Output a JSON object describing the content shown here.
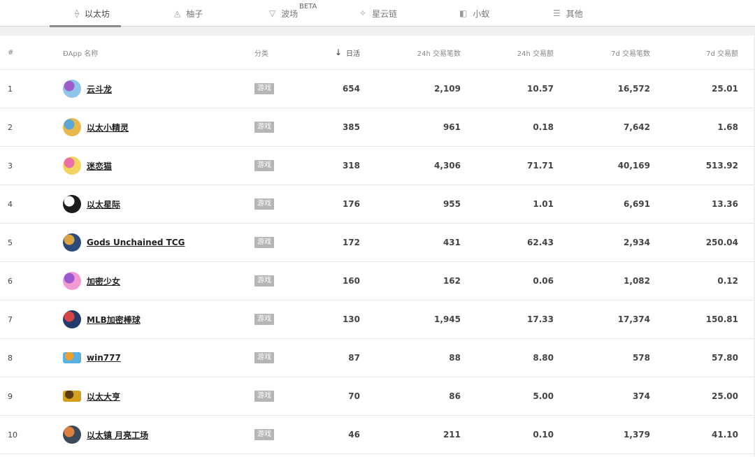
{
  "tabs": [
    {
      "label": "以太坊",
      "icon": "ethereum-icon",
      "glyph": "⟠",
      "active": true
    },
    {
      "label": "柚子",
      "icon": "eos-icon",
      "glyph": "◬"
    },
    {
      "label": "波场",
      "icon": "tron-icon",
      "glyph": "▽",
      "sup": "BETA"
    },
    {
      "label": "星云链",
      "icon": "nebulas-icon",
      "glyph": "✧"
    },
    {
      "label": "小蚁",
      "icon": "neo-icon",
      "glyph": "◧"
    },
    {
      "label": "其他",
      "icon": "menu-icon",
      "glyph": "☰"
    }
  ],
  "table": {
    "headers": {
      "rank": "#",
      "name": "ÐApp 名称",
      "category": "分类",
      "dau": "日活",
      "tx24": "24h 交易笔数",
      "vol24": "24h 交易额",
      "tx7": "7d 交易笔数",
      "vol7": "7d 交易额"
    },
    "rows": [
      {
        "rank": "1",
        "name": "云斗龙",
        "category": "游戏",
        "dau": "654",
        "tx24": "2,109",
        "vol24": "10.57",
        "tx7": "16,572",
        "vol7": "25.01",
        "avatar": "dragon-avatar",
        "color": "#8ec5e8",
        "accent": "#a05cc8"
      },
      {
        "rank": "2",
        "name": "以太小精灵",
        "category": "游戏",
        "dau": "385",
        "tx24": "961",
        "vol24": "0.18",
        "tx7": "7,642",
        "vol7": "1.68",
        "avatar": "sprite-avatar",
        "color": "#e8b84a",
        "accent": "#5aa6d6"
      },
      {
        "rank": "3",
        "name": "迷恋猫",
        "category": "游戏",
        "dau": "318",
        "tx24": "4,306",
        "vol24": "71.71",
        "tx7": "40,169",
        "vol7": "513.92",
        "avatar": "cat-avatar",
        "color": "#f4d35e",
        "accent": "#e96fa8"
      },
      {
        "rank": "4",
        "name": "以太星际",
        "category": "游戏",
        "dau": "176",
        "tx24": "955",
        "vol24": "1.01",
        "tx7": "6,691",
        "vol7": "13.36",
        "avatar": "star-avatar",
        "color": "#1c1c1c",
        "accent": "#ffffff"
      },
      {
        "rank": "5",
        "name": "Gods Unchained TCG",
        "category": "游戏",
        "dau": "172",
        "tx24": "431",
        "vol24": "62.43",
        "tx7": "2,934",
        "vol7": "250.04",
        "avatar": "gods-avatar",
        "color": "#2b4a7a",
        "accent": "#d9a441"
      },
      {
        "rank": "6",
        "name": "加密少女",
        "category": "游戏",
        "dau": "160",
        "tx24": "162",
        "vol24": "0.06",
        "tx7": "1,082",
        "vol7": "0.12",
        "avatar": "girl-avatar",
        "color": "#f29ad1",
        "accent": "#9b59d0"
      },
      {
        "rank": "7",
        "name": "MLB加密棒球",
        "category": "游戏",
        "dau": "130",
        "tx24": "1,945",
        "vol24": "17.33",
        "tx7": "17,374",
        "vol7": "150.81",
        "avatar": "baseball-avatar",
        "color": "#243a6b",
        "accent": "#d64545"
      },
      {
        "rank": "8",
        "name": "win777",
        "category": "游戏",
        "dau": "87",
        "tx24": "88",
        "vol24": "8.80",
        "tx7": "578",
        "vol7": "57.80",
        "avatar": "win777-logo",
        "color": "#5ab0e0",
        "accent": "#f0a030",
        "wide": true
      },
      {
        "rank": "9",
        "name": "以太大亨",
        "category": "游戏",
        "dau": "70",
        "tx24": "86",
        "vol24": "5.00",
        "tx7": "374",
        "vol7": "25.00",
        "avatar": "tycoon-logo",
        "color": "#d4a020",
        "accent": "#5a3a10",
        "wide": true
      },
      {
        "rank": "10",
        "name": "以太镇 月亮工场",
        "category": "游戏",
        "dau": "46",
        "tx24": "211",
        "vol24": "0.10",
        "tx7": "1,379",
        "vol7": "41.10",
        "avatar": "moon-factory-avatar",
        "color": "#3a4a5a",
        "accent": "#e08040"
      }
    ]
  }
}
